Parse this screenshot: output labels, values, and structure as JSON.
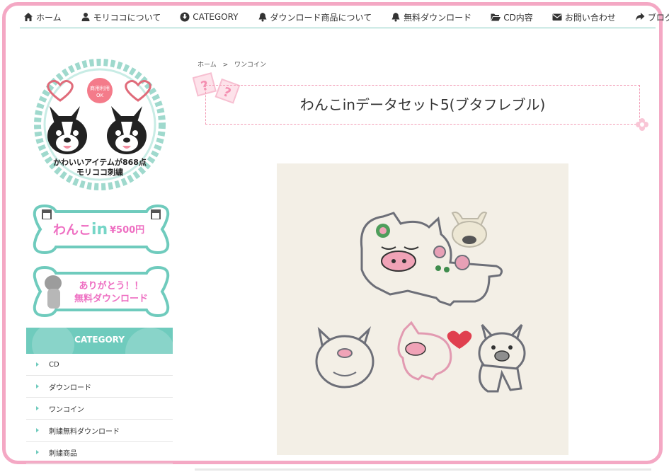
{
  "nav": [
    {
      "label": "ホーム",
      "icon": "home-icon"
    },
    {
      "label": "モリココについて",
      "icon": "user-icon"
    },
    {
      "label": "CATEGORY",
      "icon": "download-circle-icon"
    },
    {
      "label": "ダウンロード商品について",
      "icon": "bell-icon"
    },
    {
      "label": "無料ダウンロード",
      "icon": "bell-icon"
    },
    {
      "label": "CD内容",
      "icon": "folder-open-icon"
    },
    {
      "label": "お問い合わせ",
      "icon": "envelope-icon"
    },
    {
      "label": "ブログ",
      "icon": "share-arrow-icon"
    }
  ],
  "logo": {
    "badge_line1": "商用利用",
    "badge_line2": "OK",
    "caption_line1": "かわいいアイテムが868点",
    "caption_line2": "モリココ刺繍"
  },
  "banner1": {
    "text": "わんこ",
    "in": "in",
    "price": "¥500円"
  },
  "banner2": {
    "line1": "ありがとう！！",
    "line2": "無料ダウンロード"
  },
  "category": {
    "header": "CATEGORY",
    "items": [
      "CD",
      "ダウンロード",
      "ワンコイン",
      "刺繍無料ダウンロード",
      "刺繍商品"
    ]
  },
  "breadcrumb": {
    "home": "ホーム",
    "sep": ">",
    "current": "ワンコイン"
  },
  "title": "わんこinデータセット5(ブタフレブル)",
  "colors": {
    "accent": "#6fcbbd",
    "frame": "#f4a8c4",
    "title_border": "#f29bb5"
  }
}
